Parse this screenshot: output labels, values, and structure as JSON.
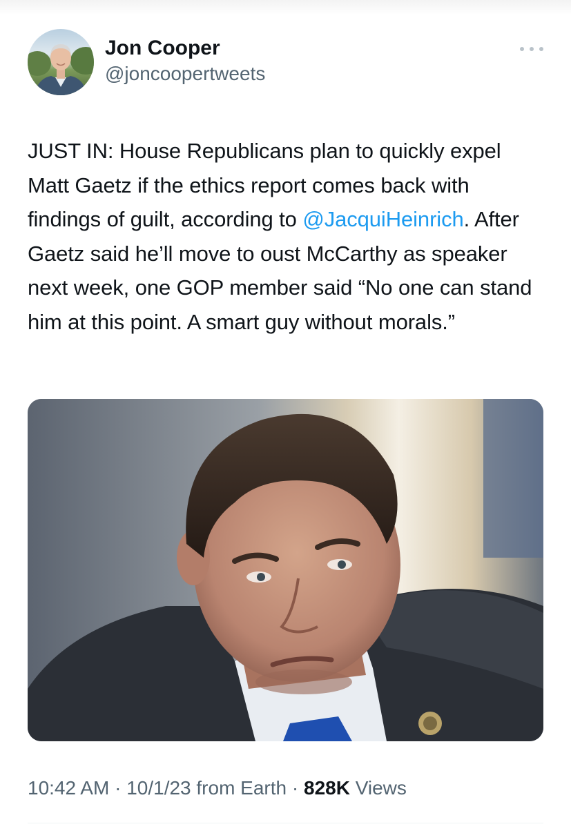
{
  "author": {
    "display_name": "Jon Cooper",
    "handle": "@joncoopertweets"
  },
  "tweet": {
    "text_1": "JUST IN: House Republicans plan to quickly expel Matt Gaetz if the ethics report comes back with findings of guilt, according to ",
    "mention": "@JacquiHeinrich",
    "text_2": ". After Gaetz said he’ll move to oust McCarthy as speaker next week, one GOP member said “No one can stand him at this point. A smart guy without morals.”"
  },
  "meta": {
    "time": "10:42 AM",
    "separator_1": " · ",
    "date": "10/1/23",
    "source": " from Earth",
    "separator_2": " · ",
    "views_count": "828K",
    "views_label": " Views"
  },
  "icons": {
    "more": "more-dots-icon"
  },
  "colors": {
    "link": "#1d9bf0",
    "text": "#0f1419",
    "secondary": "#536471"
  }
}
